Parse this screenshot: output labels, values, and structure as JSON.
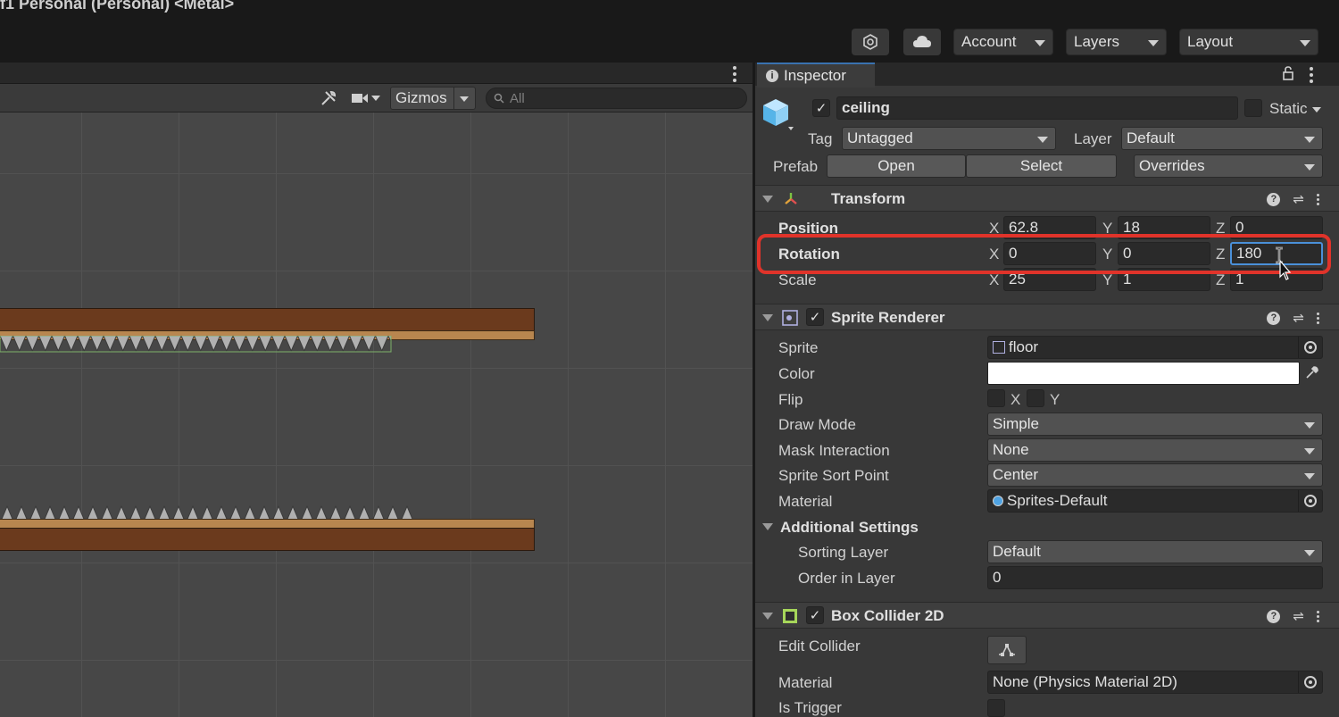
{
  "window": {
    "title": "f1 Personal (Personal) <Metal>"
  },
  "toolbar": {
    "collab_icon": "collab-icon",
    "cloud_icon": "cloud-icon",
    "account_label": "Account",
    "layers_label": "Layers",
    "layout_label": "Layout"
  },
  "scene": {
    "tools_icon": "tools-icon",
    "camera_icon": "camera-icon",
    "gizmos_label": "Gizmos",
    "search_placeholder": "All"
  },
  "inspector": {
    "tab_label": "Inspector",
    "object": {
      "active": true,
      "name": "ceiling",
      "static_label": "Static",
      "tag_label": "Tag",
      "tag_value": "Untagged",
      "layer_label": "Layer",
      "layer_value": "Default",
      "prefab_label": "Prefab",
      "open_label": "Open",
      "select_label": "Select",
      "overrides_label": "Overrides"
    },
    "transform": {
      "title": "Transform",
      "position": {
        "label": "Position",
        "x": "62.8",
        "y": "18",
        "z": "0"
      },
      "rotation": {
        "label": "Rotation",
        "x": "0",
        "y": "0",
        "z": "180"
      },
      "scale": {
        "label": "Scale",
        "x": "25",
        "y": "1",
        "z": "1"
      }
    },
    "sprite_renderer": {
      "title": "Sprite Renderer",
      "sprite_label": "Sprite",
      "sprite_value": "floor",
      "color_label": "Color",
      "color_value": "#ffffff",
      "flip_label": "Flip",
      "flip_x": "X",
      "flip_y": "Y",
      "draw_mode_label": "Draw Mode",
      "draw_mode_value": "Simple",
      "mask_label": "Mask Interaction",
      "mask_value": "None",
      "sort_point_label": "Sprite Sort Point",
      "sort_point_value": "Center",
      "material_label": "Material",
      "material_value": "Sprites-Default",
      "additional_label": "Additional Settings",
      "sorting_layer_label": "Sorting Layer",
      "sorting_layer_value": "Default",
      "order_label": "Order in Layer",
      "order_value": "0"
    },
    "box_collider": {
      "title": "Box Collider 2D",
      "edit_label": "Edit Collider",
      "material_label": "Material",
      "material_value": "None (Physics Material 2D)",
      "trigger_label": "Is Trigger"
    },
    "axis": {
      "x": "X",
      "y": "Y",
      "z": "Z"
    }
  }
}
